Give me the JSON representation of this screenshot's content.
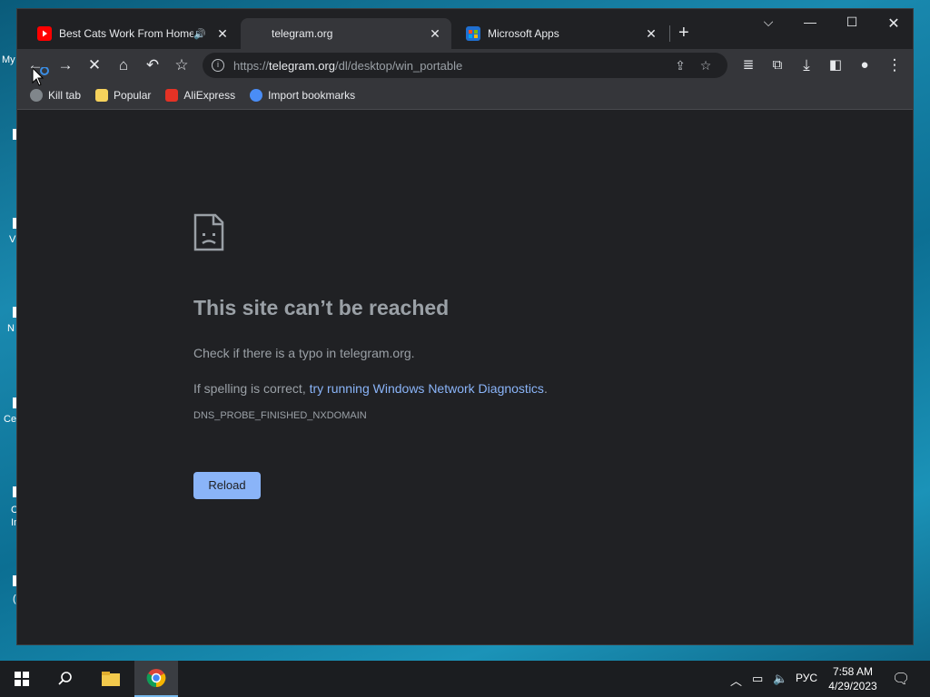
{
  "desktop": {
    "icon_labels": [
      "My",
      "V",
      "N",
      "Ce",
      "C",
      "In",
      "("
    ]
  },
  "browser": {
    "tabs": [
      {
        "title": "Best Cats Work From Home",
        "favicon": "youtube-icon",
        "audio": true,
        "active": false
      },
      {
        "title": "telegram.org",
        "favicon": "none",
        "active": true
      },
      {
        "title": "Microsoft Apps",
        "favicon": "microsoft-store-icon",
        "active": false
      }
    ],
    "omnibox": {
      "scheme": "https://",
      "host": "telegram.org",
      "path": "/dl/desktop/win_portable"
    },
    "bookmarks": [
      {
        "label": "Kill tab",
        "icon": "globe-icon"
      },
      {
        "label": "Popular",
        "icon": "folder-icon"
      },
      {
        "label": "AliExpress",
        "icon": "aliexpress-icon"
      },
      {
        "label": "Import bookmarks",
        "icon": "gear-icon"
      }
    ]
  },
  "error_page": {
    "title": "This site can’t be reached",
    "line1": "Check if there is a typo in telegram.org.",
    "line2_prefix": "If spelling is correct, ",
    "line2_link": "try running Windows Network Diagnostics",
    "line2_suffix": ".",
    "code": "DNS_PROBE_FINISHED_NXDOMAIN",
    "reload_label": "Reload"
  },
  "taskbar": {
    "language": "РУС",
    "time": "7:58 AM",
    "date": "4/29/2023"
  },
  "colors": {
    "accent_link": "#8ab4f8",
    "page_bg": "#202124",
    "toolbar_bg": "#35363a"
  }
}
